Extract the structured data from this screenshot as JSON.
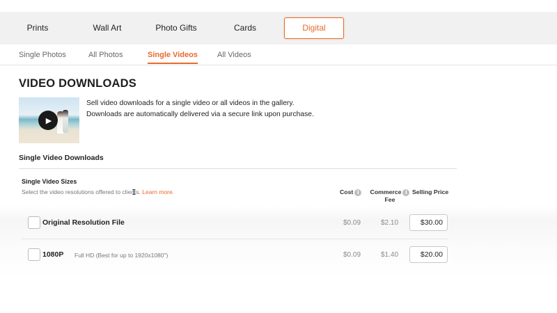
{
  "categories": [
    {
      "label": "Prints",
      "active": false
    },
    {
      "label": "Wall Art",
      "active": false
    },
    {
      "label": "Photo Gifts",
      "active": false
    },
    {
      "label": "Cards",
      "active": false
    },
    {
      "label": "Digital",
      "active": true
    }
  ],
  "sub_tabs": [
    {
      "label": "Single Photos",
      "active": false
    },
    {
      "label": "All Photos",
      "active": false
    },
    {
      "label": "Single Videos",
      "active": true
    },
    {
      "label": "All Videos",
      "active": false
    }
  ],
  "page_title": "VIDEO DOWNLOADS",
  "description": {
    "line1": "Sell video downloads for a single video or all videos in the gallery.",
    "line2": "Downloads are automatically delivered via a secure link upon purchase."
  },
  "section_title": "Single Video Downloads",
  "sizes": {
    "title": "Single Video Sizes",
    "subtitle": "Select the video resolutions offered to clients.",
    "learn_more": "Learn more."
  },
  "columns": {
    "cost": "Cost",
    "fee_line1": "Commerce",
    "fee_line2": "Fee",
    "price": "Selling Price"
  },
  "rows": [
    {
      "label": "Original Resolution File",
      "note": "",
      "cost": "$0.09",
      "fee": "$2.10",
      "price": "$30.00",
      "checked": false
    },
    {
      "label": "1080P",
      "note": "Full HD (Best for up to 1920x1080\")",
      "cost": "$0.09",
      "fee": "$1.40",
      "price": "$20.00",
      "checked": false
    }
  ],
  "colors": {
    "accent": "#e8692b",
    "tab_bar_bg": "#f1f1f1"
  },
  "icons": {
    "play": "play-icon",
    "info": "info-icon"
  }
}
